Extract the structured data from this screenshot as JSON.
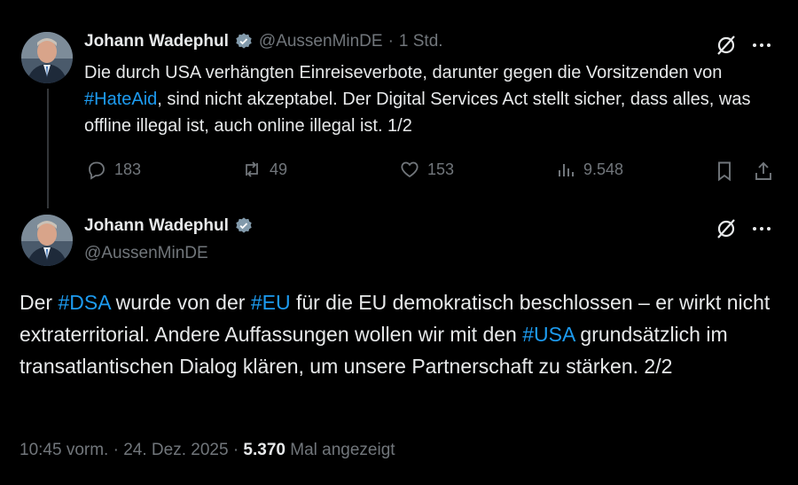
{
  "tweet1": {
    "name": "Johann Wadephul",
    "handle": "@AussenMinDE",
    "separator": "·",
    "time": "1 Std.",
    "text_1": "Die durch USA verhängten Einreiseverbote, darunter gegen die Vorsitzenden von ",
    "hashtag_hateaid": "#HateAid",
    "text_2": ", sind nicht akzeptabel. Der Digital Services Act stellt sicher, dass alles, was offline illegal ist, auch online illegal ist. 1/2",
    "replies": "183",
    "reposts": "49",
    "likes": "153",
    "views": "9.548"
  },
  "tweet2": {
    "name": "Johann Wadephul",
    "handle": "@AussenMinDE",
    "text_1": "Der ",
    "hashtag_dsa": "#DSA",
    "text_2": " wurde von der ",
    "hashtag_eu": "#EU",
    "text_3": " für die EU demokratisch beschlossen – er wirkt nicht extraterritorial. Andere Auffassungen wollen wir mit den ",
    "hashtag_usa": "#USA",
    "text_4": " grundsätzlich im transatlantischen Dialog klären, um unsere Partnerschaft zu stärken. 2/2",
    "time": "10:45 vorm.",
    "date": "24. Dez. 2025",
    "separator": "·",
    "views_count": "5.370",
    "views_label": "Mal angezeigt"
  },
  "colors": {
    "background": "#000000",
    "text": "#e7e9ea",
    "secondary": "#71767b",
    "link": "#1d9bf0",
    "verified": "#829aab"
  },
  "icons": [
    "grok-icon",
    "more-icon",
    "reply-icon",
    "repost-icon",
    "like-icon",
    "views-icon",
    "bookmark-icon",
    "share-icon",
    "verified-icon"
  ]
}
